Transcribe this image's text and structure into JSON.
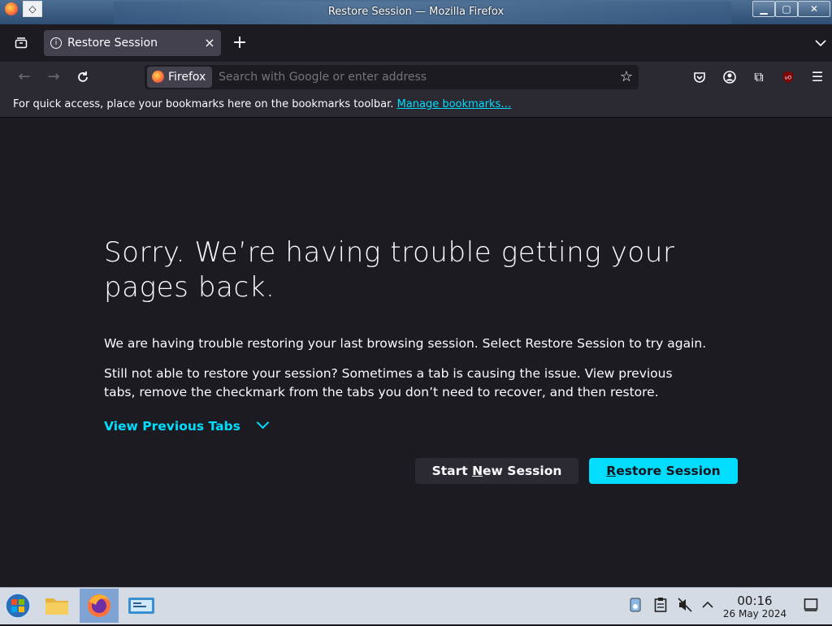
{
  "window": {
    "title": "Restore Session — Mozilla Firefox"
  },
  "tabstrip": {
    "tab_label": "Restore Session",
    "new_tab": "+",
    "close": "×"
  },
  "navbar": {
    "identity_label": "Firefox",
    "address_placeholder": "Search with Google or enter address"
  },
  "bookmarks": {
    "message": "For quick access, place your bookmarks here on the bookmarks toolbar. ",
    "manage_link": "Manage bookmarks…"
  },
  "content": {
    "heading": "Sorry. We’re having trouble getting your pages back.",
    "para1": "We are having trouble restoring your last browsing session. Select Restore Session to try again.",
    "para2": "Still not able to restore your session? Sometimes a tab is causing the issue. View previous tabs, remove the checkmark from the tabs you don’t need to recover, and then restore.",
    "view_previous": "View Previous Tabs",
    "btn_new": {
      "pre": "Start ",
      "key": "N",
      "post": "ew Session"
    },
    "btn_restore": {
      "key": "R",
      "post": "estore Session"
    }
  },
  "taskbar": {
    "time": "00:16",
    "date": "26 May 2024"
  },
  "colors": {
    "accent": "#00ddff",
    "background": "#1c1b22",
    "toolbar": "#2b2a33"
  },
  "icons": [
    "firefox-icon",
    "pin-icon",
    "minimize-icon",
    "maximize-icon",
    "close-icon",
    "tab-overview-icon",
    "info-icon",
    "chevron-down-icon",
    "back-icon",
    "forward-icon",
    "reload-icon",
    "star-icon",
    "pocket-icon",
    "account-icon",
    "extensions-icon",
    "ublock-icon",
    "menu-icon",
    "start-menu-icon",
    "file-manager-icon",
    "terminal-icon",
    "clipboard-icon",
    "volume-muted-icon",
    "tray-expand-icon",
    "show-desktop-icon"
  ]
}
